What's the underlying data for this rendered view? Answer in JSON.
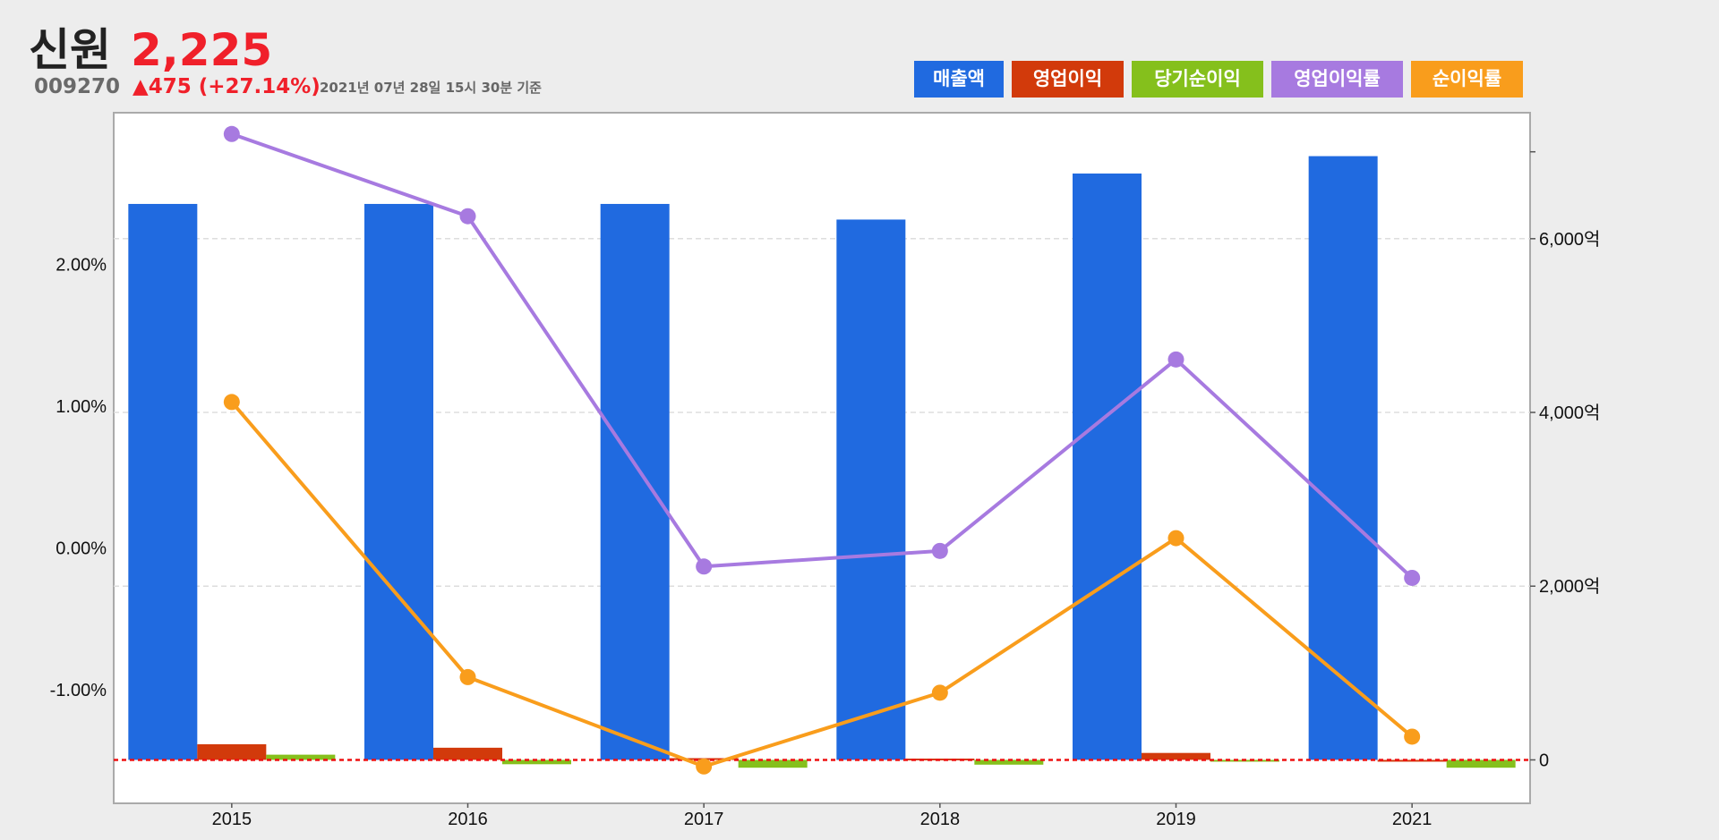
{
  "header": {
    "stock_name": "신원",
    "price": "2,225",
    "code": "009270",
    "change": "▲475 (+27.14%)",
    "timestamp": "2021년 07년 28일 15시 30분 기준"
  },
  "legend": [
    {
      "label": "매출액",
      "color": "#206ae0"
    },
    {
      "label": "영업이익",
      "color": "#d23a0b"
    },
    {
      "label": "당기순이익",
      "color": "#85c01c"
    },
    {
      "label": "영업이익률",
      "color": "#a77ae0"
    },
    {
      "label": "순이익률",
      "color": "#f99d1c"
    }
  ],
  "chart_data": {
    "type": "bar",
    "categories": [
      "2015",
      "2016",
      "2017",
      "2018",
      "2019",
      "2021"
    ],
    "series": [
      {
        "name": "매출액",
        "kind": "bar",
        "axis": "right",
        "color": "#206ae0",
        "values": [
          6400,
          6400,
          6400,
          6220,
          6750,
          6950
        ]
      },
      {
        "name": "영업이익",
        "kind": "bar",
        "axis": "right",
        "color": "#d23a0b",
        "values": [
          180,
          140,
          20,
          15,
          80,
          0
        ]
      },
      {
        "name": "당기순이익",
        "kind": "bar",
        "axis": "right",
        "color": "#85c01c",
        "values": [
          60,
          -50,
          -90,
          -55,
          0,
          -90
        ]
      },
      {
        "name": "영업이익률",
        "kind": "line",
        "axis": "left",
        "color": "#a77ae0",
        "values": [
          2.92,
          2.34,
          -0.13,
          -0.02,
          1.33,
          -0.21
        ]
      },
      {
        "name": "순이익률",
        "kind": "line",
        "axis": "left",
        "color": "#f99d1c",
        "values": [
          1.03,
          -0.91,
          -1.54,
          -1.02,
          0.07,
          -1.33
        ]
      }
    ],
    "left_axis": {
      "min": -1.8,
      "max": 3.07,
      "ticks": [
        -1,
        0,
        1,
        2
      ],
      "tick_labels": [
        "-1.00%",
        "0.00%",
        "1.00%",
        "2.00%"
      ]
    },
    "right_axis": {
      "min": -500,
      "max": 7450,
      "ticks": [
        0,
        2000,
        4000,
        6000,
        7000
      ],
      "tick_labels": [
        "0",
        "2,000억",
        "4,000억",
        "6,000억",
        ""
      ]
    },
    "zero_line_color": "#ee1111",
    "grid": true
  }
}
